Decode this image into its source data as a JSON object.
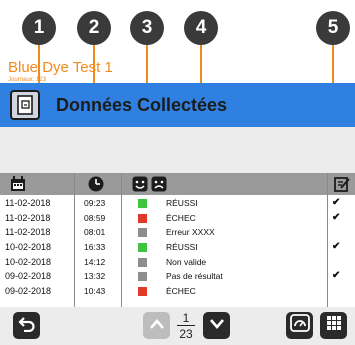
{
  "callouts": [
    "1",
    "2",
    "3",
    "4",
    "5"
  ],
  "header": {
    "title": "Données Collectées",
    "icon": "document-icon"
  },
  "test": {
    "name": "Blue Dye Test 1",
    "journals": "Journaux: 123"
  },
  "columns": {
    "date_icon": "calendar-icon",
    "time_icon": "clock-icon",
    "result_icons": [
      "smile-icon",
      "frown-icon"
    ],
    "action_icon": "edit-icon"
  },
  "rows": [
    {
      "date": "11-02-2018",
      "time": "09:23",
      "status": "green",
      "result": "RÉUSSI",
      "check": "✔"
    },
    {
      "date": "11-02-2018",
      "time": "08:59",
      "status": "red",
      "result": "ÉCHEC",
      "check": "✔"
    },
    {
      "date": "11-02-2018",
      "time": "08:01",
      "status": "gray",
      "result": "Erreur XXXX",
      "check": ""
    },
    {
      "date": "10-02-2018",
      "time": "16:33",
      "status": "green",
      "result": "RÉUSSI",
      "check": "✔"
    },
    {
      "date": "10-02-2018",
      "time": "14:12",
      "status": "gray",
      "result": "Non valide",
      "check": ""
    },
    {
      "date": "09-02-2018",
      "time": "13:32",
      "status": "gray",
      "result": "Pas de résultat",
      "check": "✔"
    },
    {
      "date": "09-02-2018",
      "time": "10:43",
      "status": "red",
      "result": "ÉCHEC",
      "check": ""
    }
  ],
  "status_colors": {
    "green": "#3ec43e",
    "red": "#e23a2a",
    "gray": "#8e8e8e"
  },
  "pagination": {
    "current": "1",
    "total": "23"
  },
  "footer": {
    "back_icon": "back-arrow-icon",
    "up_icon": "chevron-up-icon",
    "down_icon": "chevron-down-icon",
    "gauge_icon": "gauge-icon",
    "grid_icon": "grid-icon"
  }
}
